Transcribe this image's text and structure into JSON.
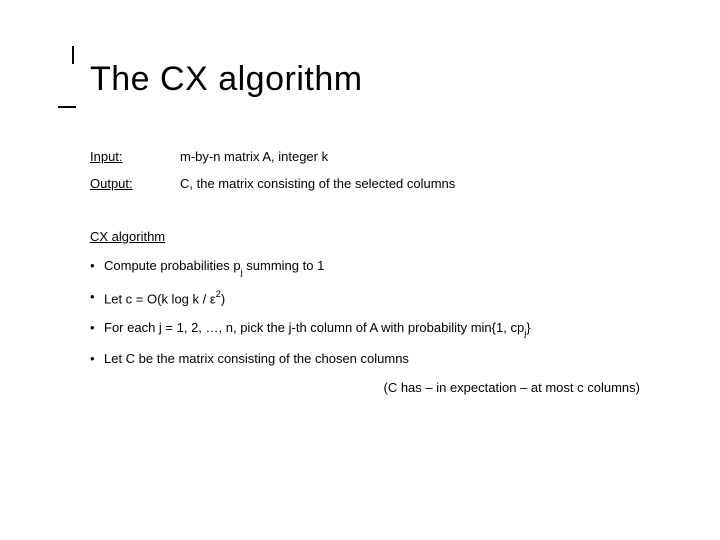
{
  "title": "The CX algorithm",
  "io": {
    "input_label": "Input:",
    "input_value": "m-by-n matrix A, integer k",
    "output_label": "Output:",
    "output_value": "C, the matrix consisting of the selected columns"
  },
  "section": "CX algorithm",
  "bullets": {
    "b1_pre": "Compute probabilities p",
    "b1_sub": "j",
    "b1_post": " summing to 1",
    "b2_pre": "Let c = O(k log k / ε",
    "b2_sup": "2",
    "b2_post": ")",
    "b3_pre": "For each j = 1, 2, …, n, pick the j-th column of A with probability min{1, cp",
    "b3_sub": "j",
    "b3_post": "}",
    "b4": "Let C be the matrix consisting of the chosen columns"
  },
  "footnote": "(C has – in expectation – at most c columns)"
}
